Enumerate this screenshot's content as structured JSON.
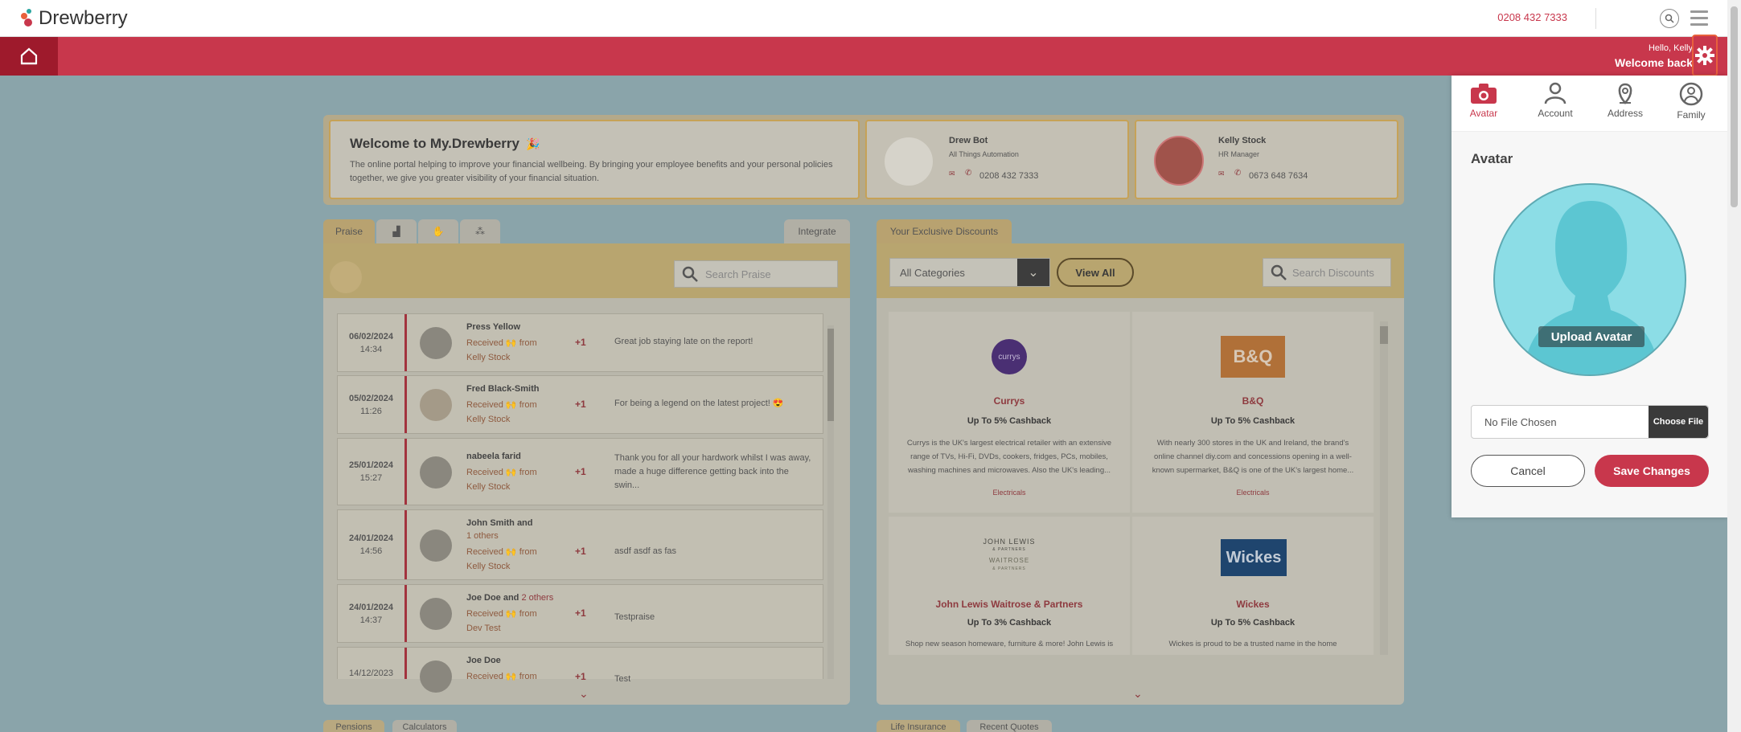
{
  "header": {
    "brand": "Drewberry",
    "phone": "0208 432 7333",
    "hello": "Hello, Kelly",
    "welcome": "Welcome back"
  },
  "welcome_card": {
    "title": "Welcome to My.Drewberry",
    "text": "The online portal helping to improve your financial wellbeing. By bringing your employee benefits and your personal policies together, we give you greater visibility of your financial situation."
  },
  "contacts": [
    {
      "name": "Drew Bot",
      "role": "All Things Automation",
      "phone": "0208 432 7333"
    },
    {
      "name": "Kelly Stock",
      "role": "HR Manager",
      "phone": "0673 648 7634"
    }
  ],
  "praise": {
    "tab_label": "Praise",
    "integrate_label": "Integrate",
    "search_placeholder": "Search Praise",
    "received_label": "Received",
    "from_label": "from",
    "rows": [
      {
        "date": "06/02/2024",
        "time": "14:34",
        "name": "Press Yellow",
        "from": "Kelly Stock",
        "points": "+1",
        "message": "Great job staying late on the report!"
      },
      {
        "date": "05/02/2024",
        "time": "11:26",
        "name": "Fred Black-Smith",
        "from": "Kelly Stock",
        "points": "+1",
        "message": "For being a legend on the latest project! 😍"
      },
      {
        "date": "25/01/2024",
        "time": "15:27",
        "name": "nabeela farid",
        "from": "Kelly Stock",
        "points": "+1",
        "message": "Thank you for all your hardwork whilst I was away, made a huge difference getting back into the swin..."
      },
      {
        "date": "24/01/2024",
        "time": "14:56",
        "name": "John Smith and",
        "extra": "1 others",
        "from": "Kelly Stock",
        "points": "+1",
        "message": "asdf asdf as fas"
      },
      {
        "date": "24/01/2024",
        "time": "14:37",
        "name": "Joe Doe and",
        "extra": "2 others",
        "from": "Dev Test",
        "points": "+1",
        "message": "Testpraise"
      },
      {
        "date": "14/12/2023",
        "time": "",
        "name": "Joe Doe",
        "from": "",
        "points": "+1",
        "message": "Test"
      }
    ]
  },
  "discounts": {
    "tab_label": "Your Exclusive Discounts",
    "category_select": "All Categories",
    "view_all": "View All",
    "search_placeholder": "Search Discounts",
    "items": [
      {
        "brand": "Currys",
        "logo": "currys",
        "cashback": "Up To 5% Cashback",
        "desc": "Currys is the UK's largest electrical retailer with an extensive range of TVs, Hi-Fi, DVDs, cookers, fridges, PCs, mobiles, washing machines and microwaves. Also the UK's leading...",
        "category": "Electricals"
      },
      {
        "brand": "B&Q",
        "logo": "B&Q",
        "cashback": "Up To 5% Cashback",
        "desc": "With nearly 300 stores in the UK and Ireland, the brand's online channel diy.com and concessions opening in a well-known supermarket, B&Q is one of the UK's largest home...",
        "category": "Electricals"
      },
      {
        "brand": "John Lewis Waitrose & Partners",
        "logo_line1": "JOHN LEWIS",
        "logo_line2": "& PARTNERS",
        "logo_line3": "WAITROSE",
        "logo_line4": "& PARTNERS",
        "cashback": "Up To 3% Cashback",
        "desc": "Shop new season homeware, furniture & more! John Lewis is",
        "category": ""
      },
      {
        "brand": "Wickes",
        "logo": "Wickes",
        "cashback": "Up To 5% Cashback",
        "desc": "Wickes is proud to be a trusted name in the home",
        "category": ""
      }
    ]
  },
  "bottom_tabs": {
    "left": [
      "Pensions",
      "Calculators"
    ],
    "right": [
      "Life Insurance",
      "Recent Quotes"
    ]
  },
  "settings_panel": {
    "tabs": [
      "Avatar",
      "Account",
      "Address",
      "Family"
    ],
    "heading": "Avatar",
    "upload_label": "Upload Avatar",
    "file_status": "No File Chosen",
    "choose_file": "Choose File",
    "cancel": "Cancel",
    "save": "Save Changes",
    "accent": "#c8374c"
  }
}
